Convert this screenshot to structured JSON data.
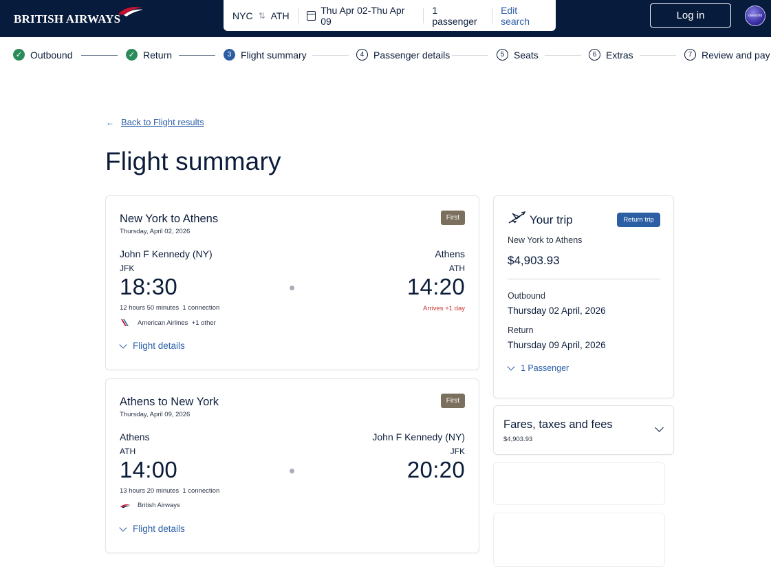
{
  "header": {
    "brand": "BRITISH AIRWAYS",
    "search": {
      "origin": "NYC",
      "destination": "ATH",
      "dates": "Thu Apr 02-Thu Apr 09",
      "passengers": "1 passenger",
      "edit_label": "Edit search"
    },
    "login_label": "Log in",
    "alliance_label": "oneworld"
  },
  "steps": [
    {
      "marker": "✓",
      "label": "Outbound",
      "state": "done"
    },
    {
      "marker": "✓",
      "label": "Return",
      "state": "done"
    },
    {
      "marker": "3",
      "label": "Flight summary",
      "state": "current"
    },
    {
      "marker": "4",
      "label": "Passenger details",
      "state": "todo"
    },
    {
      "marker": "5",
      "label": "Seats",
      "state": "todo"
    },
    {
      "marker": "6",
      "label": "Extras",
      "state": "todo"
    },
    {
      "marker": "7",
      "label": "Review and pay",
      "state": "todo"
    }
  ],
  "main": {
    "back_arrow": "←",
    "back_label": "Back to Flight results",
    "title": "Flight summary"
  },
  "flights": [
    {
      "title": "New York to Athens",
      "date": "Thursday, April 02, 2026",
      "cabin": "First",
      "from_name": "John F Kennedy (NY)",
      "from_code": "JFK",
      "depart_time": "18:30",
      "to_name": "Athens",
      "to_code": "ATH",
      "arrive_time": "14:20",
      "duration": "12 hours 50 minutes",
      "connections": "1 connection",
      "arrives_note": "Arrives +1 day",
      "carrier": "American Airlines",
      "carrier_extra": "+1 other",
      "details_label": "Flight details"
    },
    {
      "title": "Athens to New York",
      "date": "Thursday, April 09, 2026",
      "cabin": "First",
      "from_name": "Athens",
      "from_code": "ATH",
      "depart_time": "14:00",
      "to_name": "John F Kennedy (NY)",
      "to_code": "JFK",
      "arrive_time": "20:20",
      "duration": "13 hours 20 minutes",
      "connections": "1 connection",
      "carrier": "British Airways",
      "details_label": "Flight details"
    }
  ],
  "trip": {
    "title": "Your trip",
    "badge": "Return trip",
    "route": "New York to Athens",
    "price": "$4,903.93",
    "outbound_label": "Outbound",
    "outbound_date": "Thursday 02 April, 2026",
    "return_label": "Return",
    "return_date": "Thursday 09 April, 2026",
    "passengers_label": "1 Passenger"
  },
  "fares": {
    "title": "Fares, taxes and fees",
    "amount": "$4,903.93"
  },
  "colors": {
    "navy": "#071b3c",
    "link": "#2b5fa8",
    "done": "#2c8b5a",
    "current": "#2c5ea3",
    "first_badge": "#7b6f5d",
    "warning": "#c8332f"
  }
}
